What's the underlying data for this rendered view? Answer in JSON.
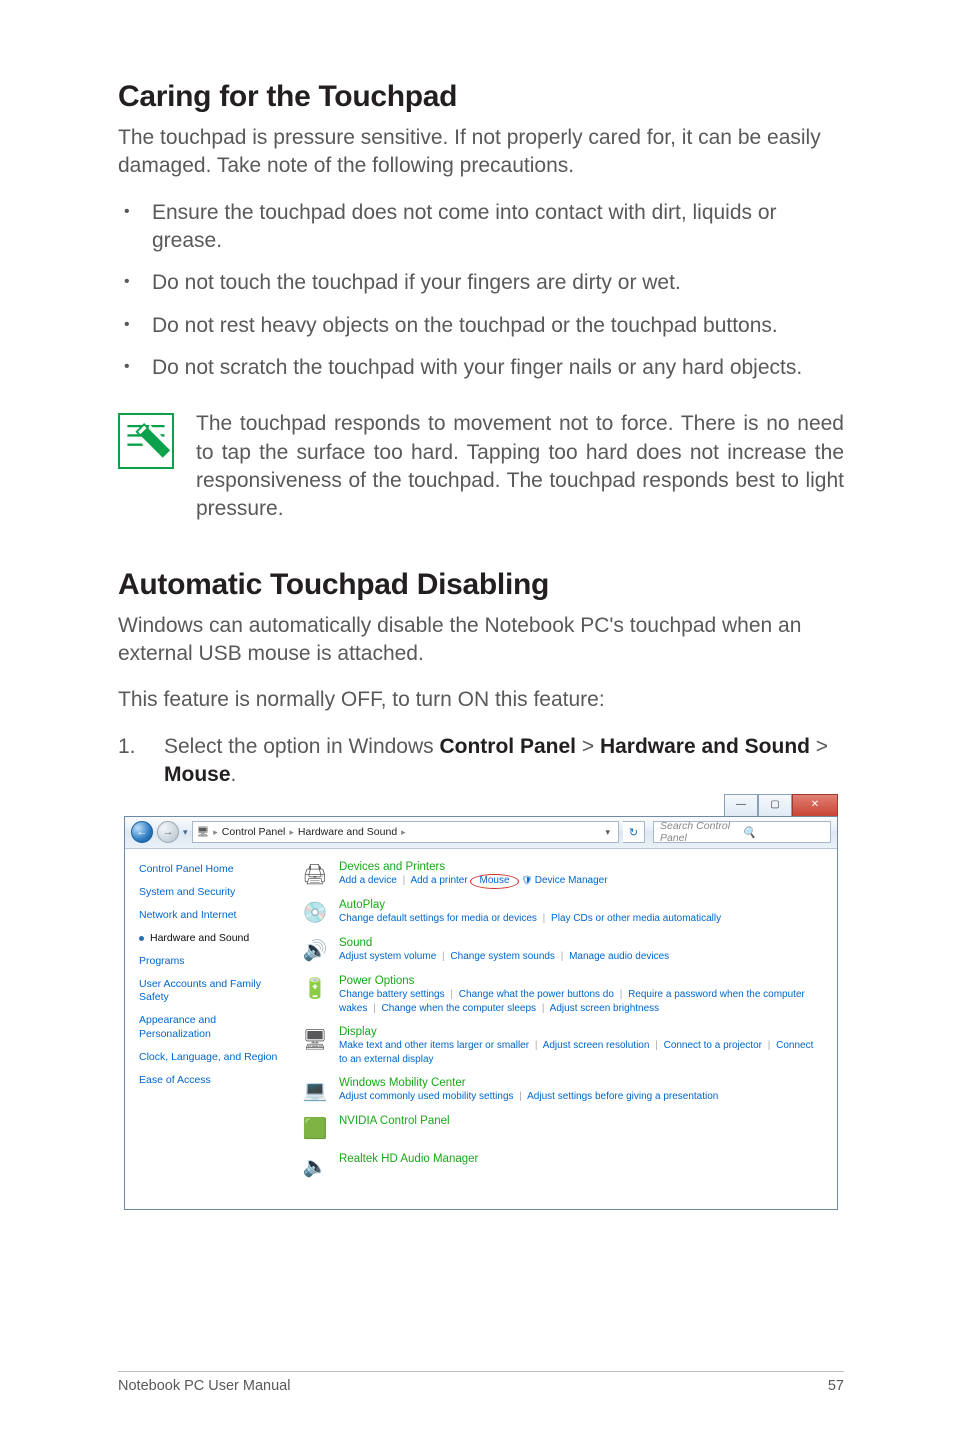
{
  "section1": {
    "title": "Caring for the Touchpad",
    "intro": "The touchpad is pressure sensitive. If not properly cared for, it can be easily damaged. Take note of the following precautions.",
    "bullets": [
      "Ensure the touchpad does not come into contact with dirt, liquids or grease.",
      "Do not touch the touchpad if your fingers are dirty or wet.",
      "Do not rest heavy objects on the touchpad or the touchpad buttons.",
      "Do not scratch the touchpad with your finger nails or any hard objects."
    ],
    "note": "The touchpad responds to movement not to force. There is no need to tap the surface too hard. Tapping too hard does not increase the responsiveness of the touchpad. The touchpad responds best to light pressure."
  },
  "section2": {
    "title": "Automatic Touchpad Disabling",
    "p1": "Windows can automatically disable the Notebook PC's touchpad when an external USB mouse is attached.",
    "p2": "This feature is normally OFF, to turn ON this feature:",
    "step_num": "1.",
    "step_pre": "Select the option in Windows ",
    "step_b1": "Control Panel",
    "step_gt1": " > ",
    "step_b2": "Hardware and Sound",
    "step_gt2": " > ",
    "step_b3": "Mouse",
    "step_post": "."
  },
  "cp": {
    "btn_min": "—",
    "btn_max": "▢",
    "btn_close": "✕",
    "back_glyph": "←",
    "fwd_glyph": "→",
    "tri": "▾",
    "refresh": "↻",
    "crumb_root_icon": "🖥",
    "crumb1": "Control Panel",
    "crumb2": "Hardware and Sound",
    "search_placeholder": "Search Control Panel",
    "mag": "🔍",
    "sidebar": {
      "home": "Control Panel Home",
      "items": [
        "System and Security",
        "Network and Internet",
        "Hardware and Sound",
        "Programs",
        "User Accounts and Family Safety",
        "Appearance and Personalization",
        "Clock, Language, and Region",
        "Ease of Access"
      ]
    },
    "cats": [
      {
        "icon": "🖨",
        "title": "Devices and Printers",
        "links_html": "Add a device | Add a printer <span class='circled'>Mouse</span> <span class='shield'>🛡</span>Device Manager"
      },
      {
        "icon": "💿",
        "title": "AutoPlay",
        "links_html": "Change default settings for media or devices | Play CDs or other media automatically"
      },
      {
        "icon": "🔊",
        "title": "Sound",
        "links_html": "Adjust system volume | Change system sounds | Manage audio devices"
      },
      {
        "icon": "🔋",
        "title": "Power Options",
        "links_html": "Change battery settings | Change what the power buttons do | Require a password when the computer wakes | Change when the computer sleeps | Adjust screen brightness"
      },
      {
        "icon": "🖥",
        "title": "Display",
        "links_html": "Make text and other items larger or smaller | Adjust screen resolution | Connect to a projector | Connect to an external display"
      },
      {
        "icon": "💻",
        "title": "Windows Mobility Center",
        "links_html": "Adjust commonly used mobility settings | Adjust settings before giving a presentation"
      },
      {
        "icon": "🟩",
        "title": "NVIDIA Control Panel",
        "links_html": ""
      },
      {
        "icon": "🔈",
        "title": "Realtek HD Audio Manager",
        "links_html": ""
      }
    ]
  },
  "footer": {
    "left": "Notebook PC User Manual",
    "right": "57"
  }
}
